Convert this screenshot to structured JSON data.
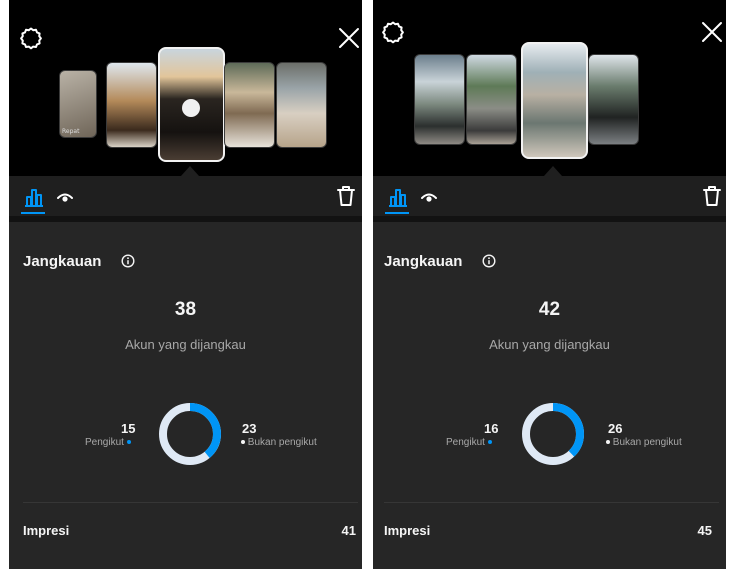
{
  "colors": {
    "accent": "#0095f6",
    "secondary_segment": "#dfe9f5",
    "background": "#262626"
  },
  "icons": {
    "settings": "gear-icon",
    "close": "close-icon",
    "insights": "bar-chart-icon",
    "views": "eye-icon",
    "delete": "trash-icon",
    "info": "info-icon"
  },
  "panels": [
    {
      "thumbnail_caption": "Repat",
      "section_title": "Jangkauan",
      "reach": {
        "value": "38",
        "label": "Akun yang dijangkau",
        "followers": {
          "value": "15",
          "label": "Pengikut",
          "fraction": 0.39
        },
        "non_followers": {
          "value": "23",
          "label": "Bukan pengikut",
          "fraction": 0.61
        }
      },
      "impressions": {
        "label": "Impresi",
        "value": "41"
      }
    },
    {
      "thumbnail_caption": "",
      "section_title": "Jangkauan",
      "reach": {
        "value": "42",
        "label": "Akun yang dijangkau",
        "followers": {
          "value": "16",
          "label": "Pengikut",
          "fraction": 0.38
        },
        "non_followers": {
          "value": "26",
          "label": "Bukan pengikut",
          "fraction": 0.62
        }
      },
      "impressions": {
        "label": "Impresi",
        "value": "45"
      }
    }
  ]
}
